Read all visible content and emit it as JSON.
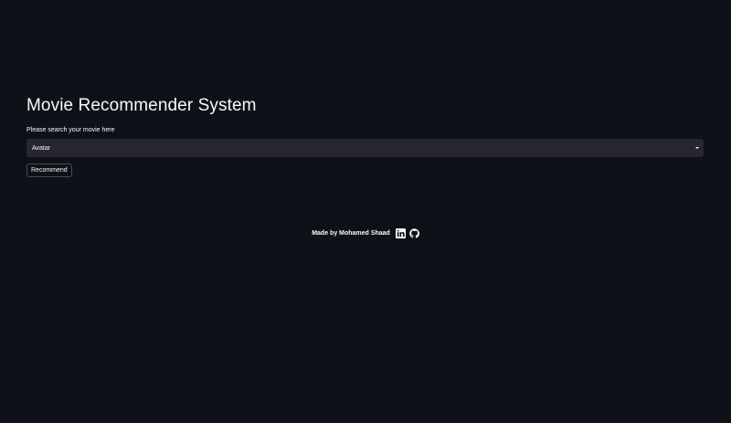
{
  "main": {
    "title": "Movie Recommender System",
    "search_label": "Please search your movie here",
    "selected_movie": "Avatar",
    "recommend_button_label": "Recommend"
  },
  "footer": {
    "credit": "Made by Mohamed Shaad",
    "links": [
      {
        "icon": "linkedin-icon"
      },
      {
        "icon": "github-icon"
      }
    ]
  },
  "colors": {
    "background": "#0e1117",
    "input_background": "#262730",
    "text": "#fafafa"
  }
}
